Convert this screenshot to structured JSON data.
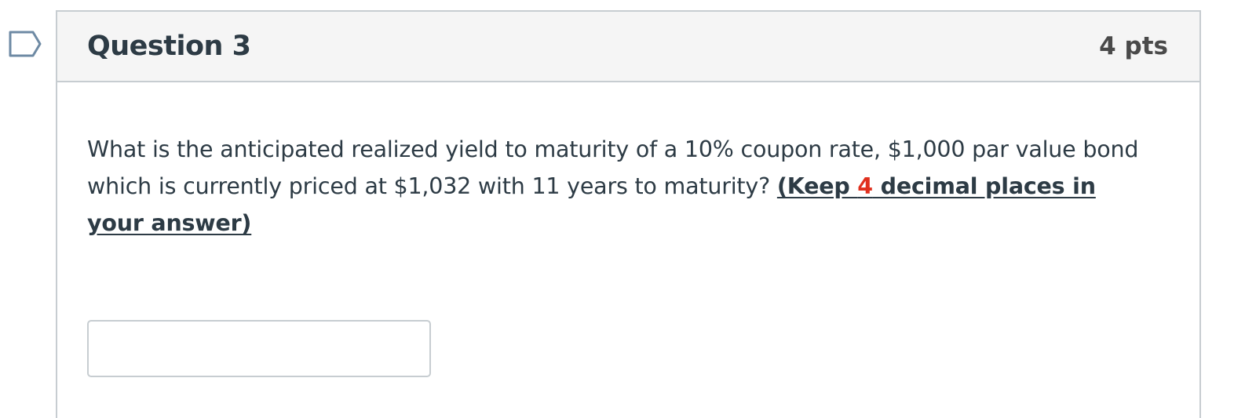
{
  "question": {
    "title": "Question 3",
    "points": "4 pts",
    "text_main": "What is the anticipated realized yield to maturity of a 10% coupon rate, $1,000 par value bond which is currently priced at $1,032 with 11 years to maturity? ",
    "emphasis_open": "(Keep ",
    "emphasis_number": "4",
    "emphasis_close": " decimal places in your answer)",
    "answer_value": "",
    "flag_icon": "bookmark-flag-icon",
    "emphasis_color": "#e0301e"
  }
}
